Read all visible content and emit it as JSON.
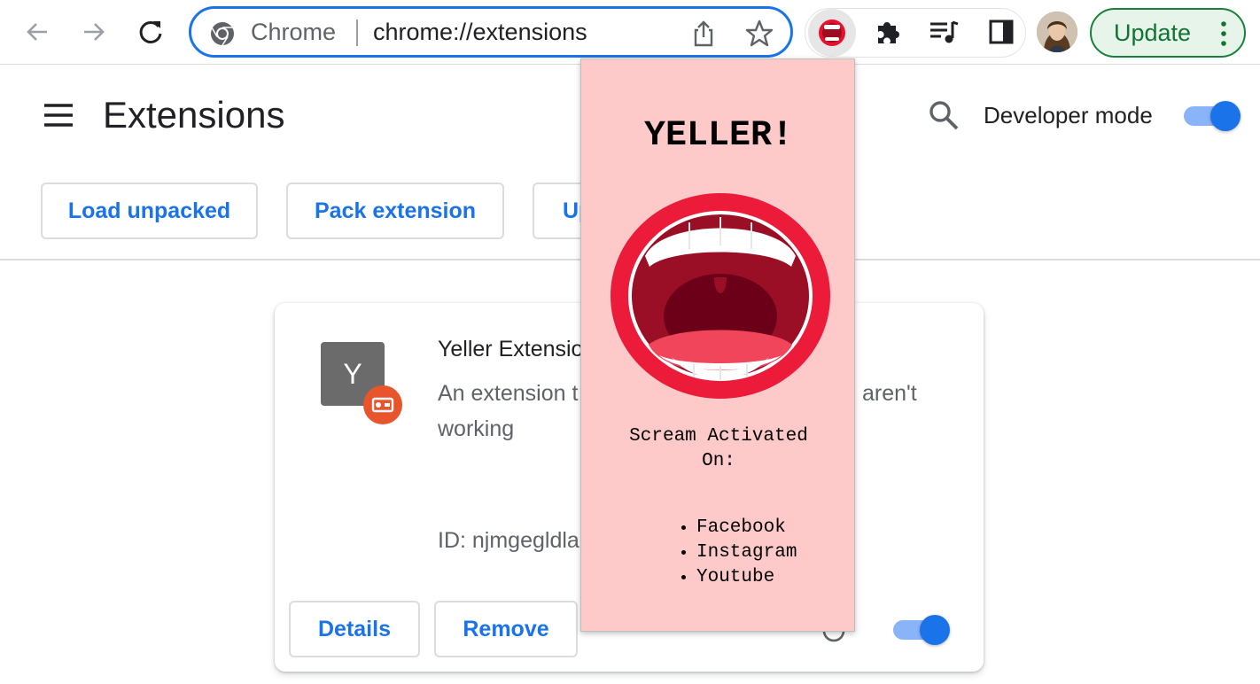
{
  "browser": {
    "omnibox": {
      "chip": "Chrome",
      "url": "chrome://extensions"
    },
    "update_label": "Update",
    "accent": "#1a73e8"
  },
  "page": {
    "title": "Extensions",
    "developer_mode_label": "Developer mode",
    "developer_mode_on": true,
    "buttons": {
      "load_unpacked": "Load unpacked",
      "pack_extension": "Pack extension",
      "update_partial": "Up"
    }
  },
  "extension_card": {
    "icon_letter": "Y",
    "name": "Yeller Extensio",
    "description_start": "An extension t",
    "description_line2": "working",
    "description_end": "aren't",
    "id": "ID: njmgegldla",
    "details_label": "Details",
    "remove_label": "Remove",
    "enabled": true
  },
  "popup": {
    "title": "YELLER!",
    "subtitle_line1": "Scream Activated",
    "subtitle_line2": "On:",
    "sites": [
      "Facebook",
      "Instagram",
      "Youtube"
    ],
    "background": "#fec9c9"
  }
}
